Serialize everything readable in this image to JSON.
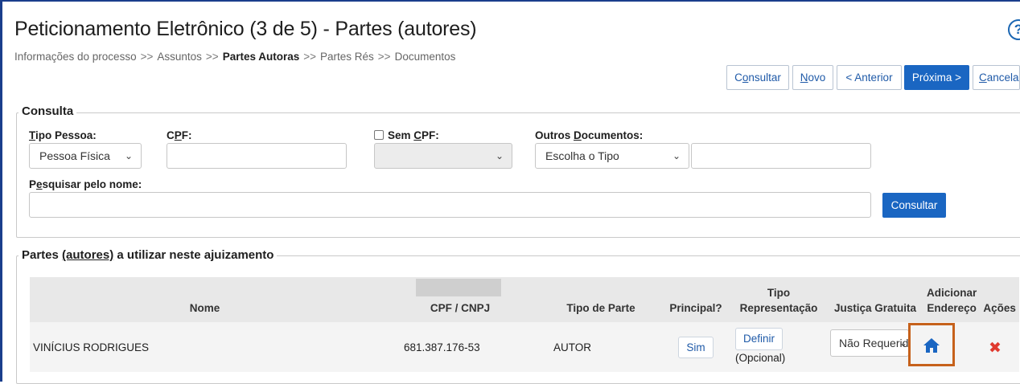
{
  "page": {
    "title": "Peticionamento Eletrônico (3 de 5) - Partes (autores)",
    "help_icon": "help-circle-icon",
    "help_glyph": "?"
  },
  "breadcrumb": {
    "steps": [
      "Informações do processo",
      "Assuntos",
      "Partes Autoras",
      "Partes Rés",
      "Documentos"
    ],
    "separator": ">>",
    "current_index": 2
  },
  "toolbar": {
    "consultar_pre": "C",
    "consultar_u": "o",
    "consultar_post": "nsultar",
    "novo_u": "N",
    "novo_post": "ovo",
    "anterior": "< Anterior",
    "proxima": "Próxima >",
    "cancelar_u": "C",
    "cancelar_post": "ancelar"
  },
  "consulta": {
    "legend": "Consulta",
    "tipo_pessoa_label_u": "T",
    "tipo_pessoa_label_rest": "ipo Pessoa:",
    "tipo_pessoa_value": "Pessoa Física",
    "cpf_label_pre": "C",
    "cpf_label_u": "P",
    "cpf_label_post": "F:",
    "cpf_value": "",
    "sem_cpf_label_pre": "Sem ",
    "sem_cpf_label_u": "C",
    "sem_cpf_label_post": "PF:",
    "sem_cpf_value": "",
    "outros_label_pre": "Outros ",
    "outros_label_u": "D",
    "outros_label_post": "ocumentos:",
    "outros_tipo_value": "Escolha o Tipo",
    "outros_numero_value": "",
    "nome_label_pre": "P",
    "nome_label_u": "e",
    "nome_label_post": "squisar pelo nome:",
    "nome_value": "",
    "consultar_button": "Consultar"
  },
  "partes": {
    "legend_pre": "Partes ",
    "legend_u": "(autores)",
    "legend_post": " a utilizar neste ajuizamento",
    "columns": {
      "nome": "Nome",
      "cpf": "CPF / CNPJ",
      "tipo_parte": "Tipo de Parte",
      "principal": "Principal?",
      "tipo_representacao_1": "Tipo",
      "tipo_representacao_2": "Representação",
      "justica_gratuita": "Justiça Gratuita",
      "endereco_1": "Adicionar",
      "endereco_2": "Endereço",
      "acoes": "Ações"
    },
    "rows": [
      {
        "nome": "VINÍCIUS RODRIGUES",
        "cpf": "681.387.176-53",
        "tipo_parte": "AUTOR",
        "principal": "Sim",
        "representacao_link": "Definir",
        "representacao_note": "(Opcional)",
        "justica_gratuita": "Não Requerida",
        "endereco_icon": "home-icon",
        "acao_icon": "delete-x-icon",
        "acao_glyph": "✖"
      }
    ]
  },
  "colors": {
    "primary": "#1a66c2",
    "link": "#1f5aa8",
    "highlight": "#c6611b",
    "delete": "#e03a2f",
    "border_accent": "#1a3e8c"
  }
}
